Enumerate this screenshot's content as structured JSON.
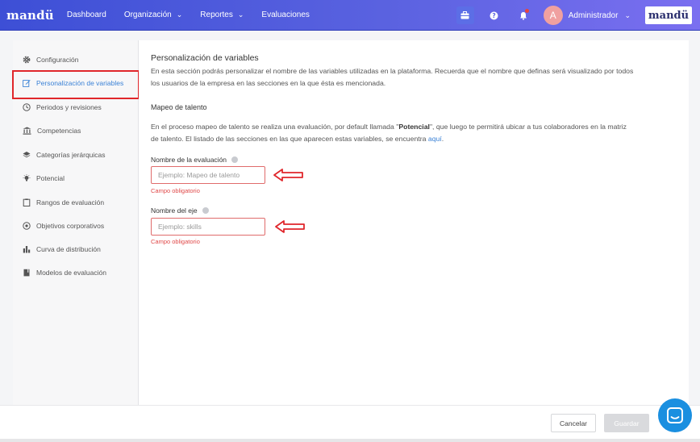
{
  "nav": {
    "logo": "mandü",
    "items": [
      {
        "label": "Dashboard",
        "has_dropdown": false
      },
      {
        "label": "Organización",
        "has_dropdown": true
      },
      {
        "label": "Reportes",
        "has_dropdown": true
      },
      {
        "label": "Evaluaciones",
        "has_dropdown": false
      }
    ],
    "user_initial": "A",
    "user_name": "Administrador",
    "brand": "mandü",
    "icons": [
      "briefcase-icon",
      "help-icon",
      "bell-icon"
    ]
  },
  "sidebar": {
    "items": [
      {
        "label": "Configuración",
        "icon": "gear-icon"
      },
      {
        "label": "Personalización de variables",
        "icon": "edit-icon",
        "active": true
      },
      {
        "label": "Periodos y revisiones",
        "icon": "clock-icon"
      },
      {
        "label": "Competencias",
        "icon": "institution-icon"
      },
      {
        "label": "Categorías jerárquicas",
        "icon": "layers-icon"
      },
      {
        "label": "Potencial",
        "icon": "bulb-icon"
      },
      {
        "label": "Rangos de evaluación",
        "icon": "clipboard-icon"
      },
      {
        "label": "Objetivos corporativos",
        "icon": "target-icon"
      },
      {
        "label": "Curva de distribución",
        "icon": "bar-chart-icon"
      },
      {
        "label": "Modelos de evaluación",
        "icon": "book-icon"
      }
    ]
  },
  "main": {
    "title": "Personalización de variables",
    "intro_line1": "En esta sección podrás personalizar el nombre de las variables utilizadas en la plataforma. Recuerda que el nombre que definas será visualizado por todos",
    "intro_line2": "los usuarios de la empresa en las secciones en la que ésta es mencionada.",
    "section_title": "Mapeo de talento",
    "desc_line1_pre": "En el proceso mapeo de talento se realiza una evaluación, por default llamada \"",
    "desc_line1_bold": "Potencial",
    "desc_line1_post": "\", que luego te permitirá ubicar a tus colaboradores en la matriz",
    "desc_line2_pre": "de talento. El listado de las secciones en las que aparecen estas variables, se encuentra ",
    "desc_link": "aquí",
    "desc_line2_post": ".",
    "fields": [
      {
        "label": "Nombre de la evaluación",
        "placeholder": "Ejemplo: Mapeo de talento",
        "value": "",
        "error": "Campo obligatorio"
      },
      {
        "label": "Nombre del eje",
        "placeholder": "Ejemplo: skills",
        "value": "",
        "error": "Campo obligatorio"
      }
    ]
  },
  "footer": {
    "cancel_label": "Cancelar",
    "save_label": "Guardar"
  },
  "colors": {
    "nav_gradient_start": "#3d4fd6",
    "nav_gradient_end": "#7a6ff0",
    "active_link": "#3b82d6",
    "error": "#e04848",
    "highlight_box": "#e0262b",
    "chat_button": "#1a8fe0"
  }
}
